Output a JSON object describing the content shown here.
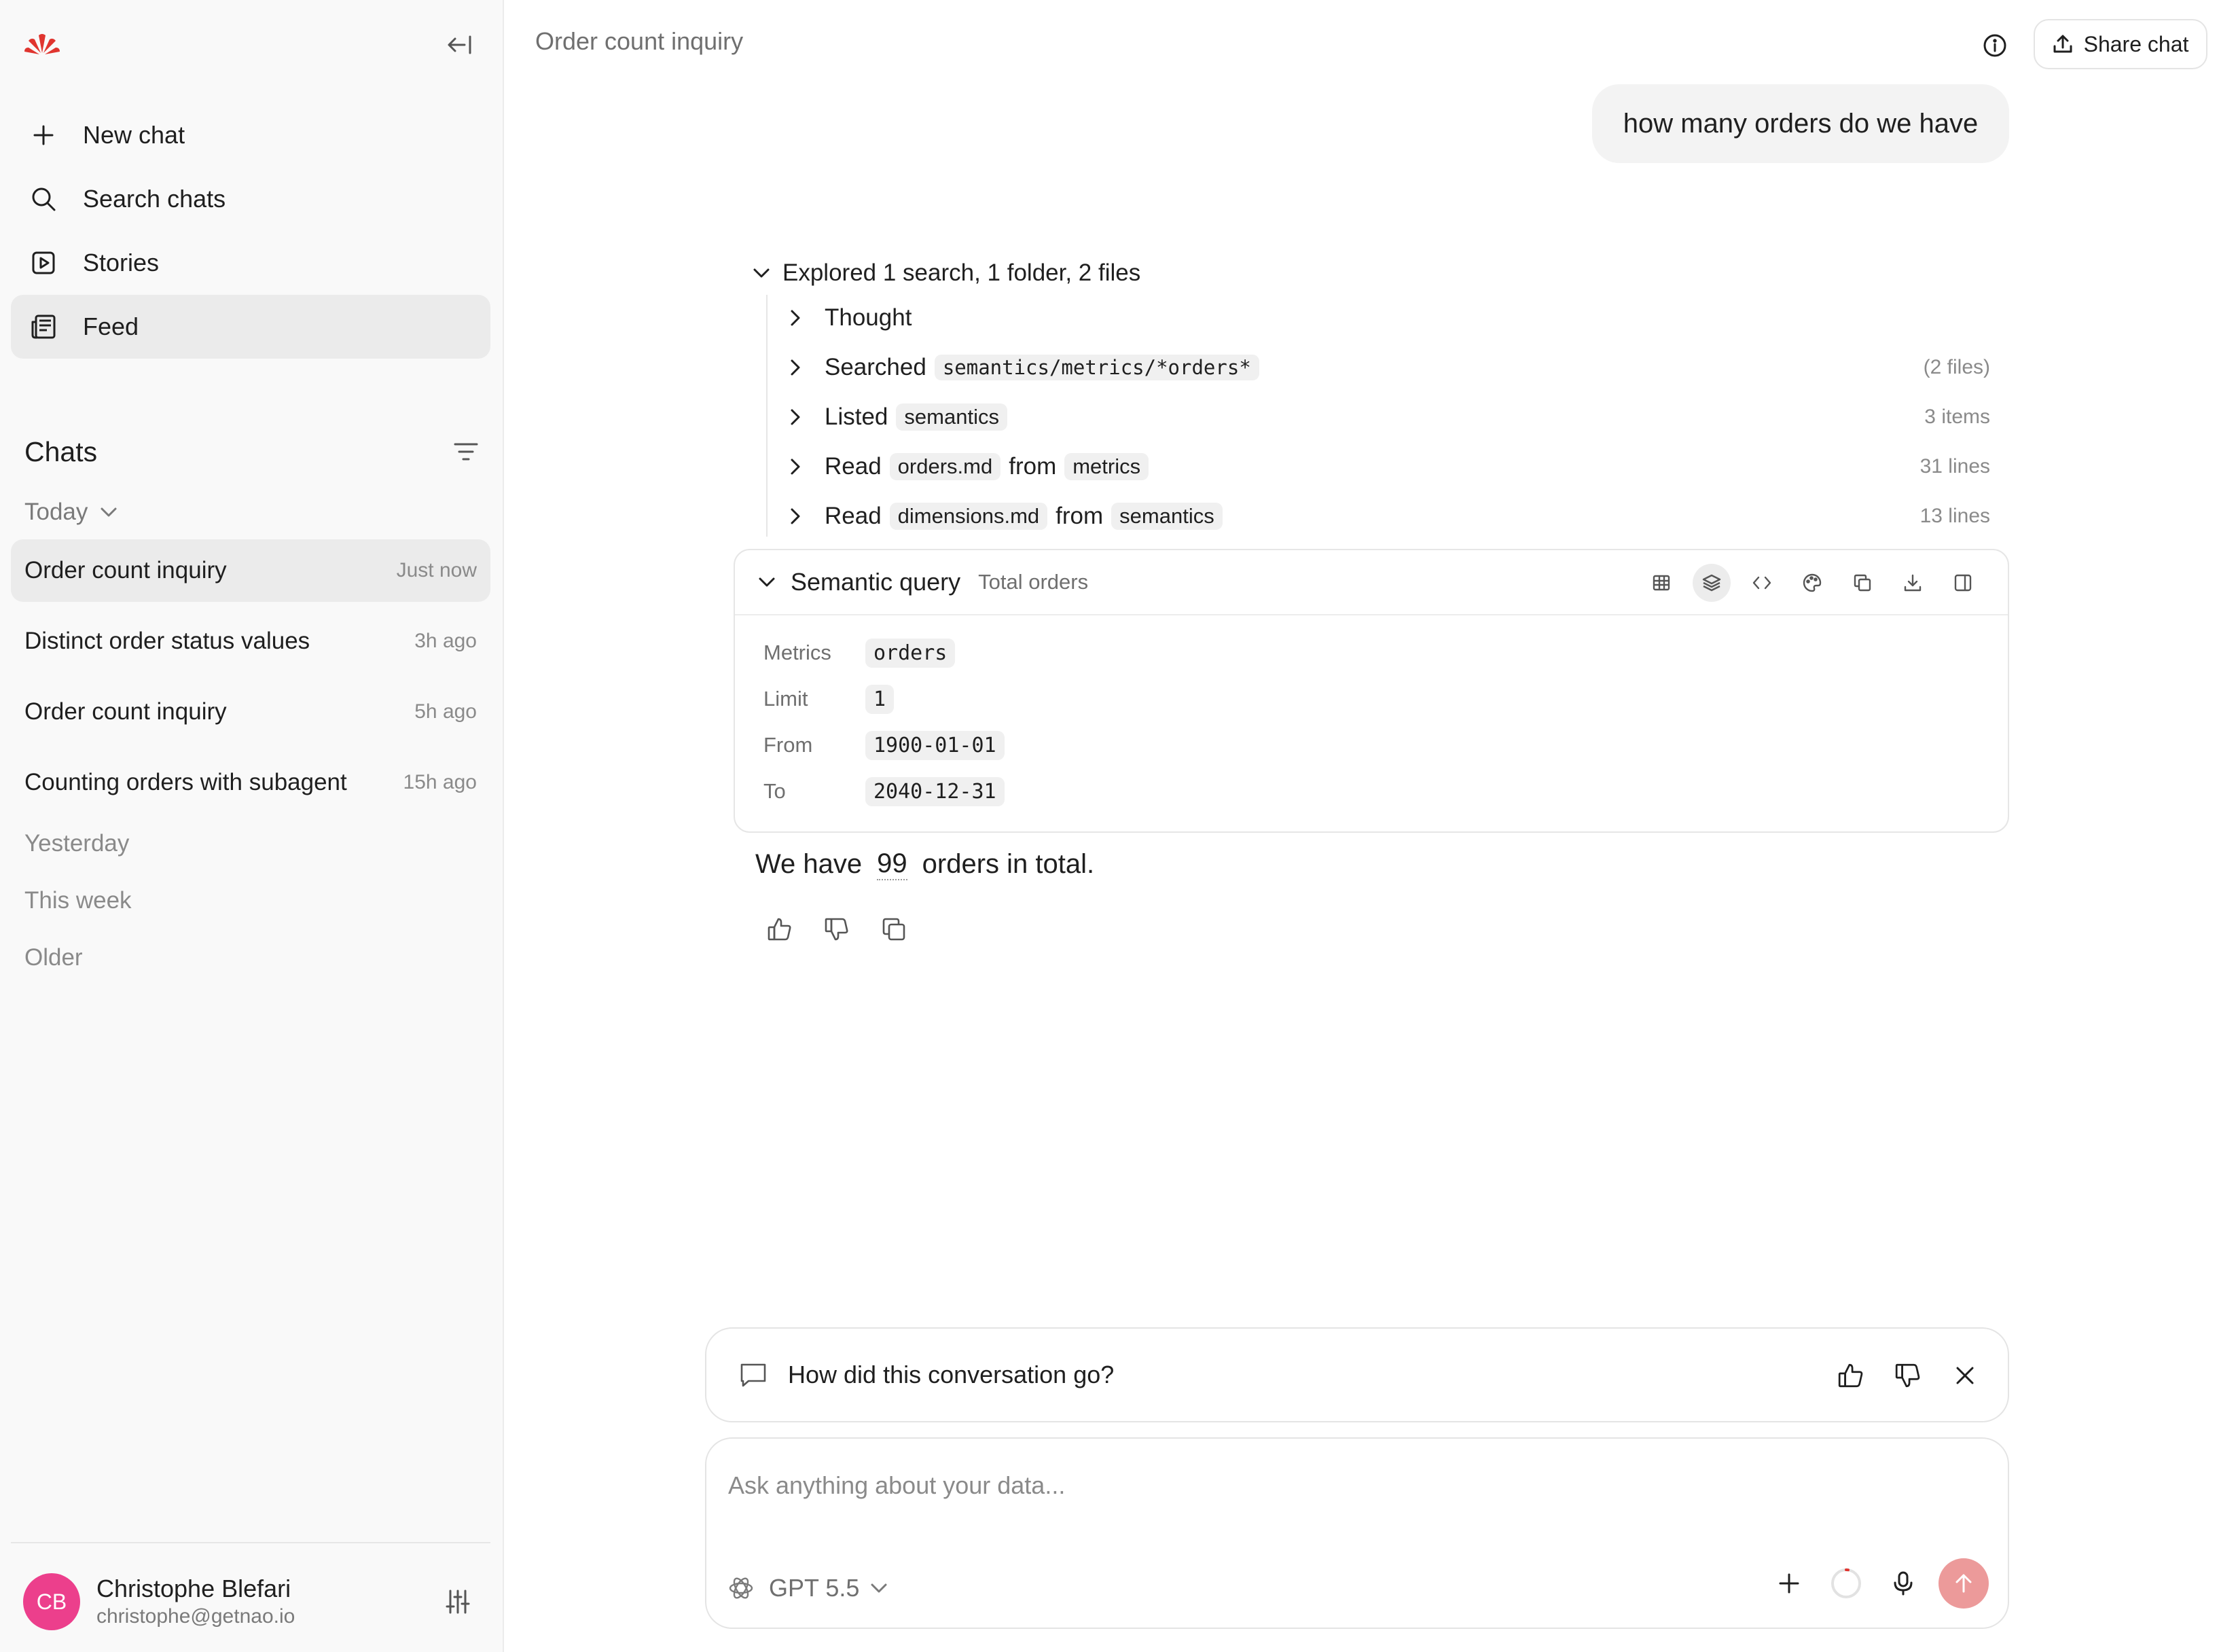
{
  "sidebar": {
    "nav": [
      {
        "label": "New chat",
        "icon": "plus-icon"
      },
      {
        "label": "Search chats",
        "icon": "search-icon"
      },
      {
        "label": "Stories",
        "icon": "play-square-icon"
      },
      {
        "label": "Feed",
        "icon": "newspaper-icon"
      }
    ],
    "chats_title": "Chats",
    "groups": {
      "today": "Today",
      "yesterday": "Yesterday",
      "this_week": "This week",
      "older": "Older"
    },
    "chats": [
      {
        "title": "Order count inquiry",
        "time": "Just now"
      },
      {
        "title": "Distinct order status values",
        "time": "3h ago"
      },
      {
        "title": "Order count inquiry",
        "time": "5h ago"
      },
      {
        "title": "Counting orders with subagent",
        "time": "15h ago"
      }
    ],
    "user": {
      "initials": "CB",
      "name": "Christophe Blefari",
      "email": "christophe@getnao.io"
    }
  },
  "header": {
    "title": "Order count inquiry",
    "share_label": "Share chat"
  },
  "conversation": {
    "user_message": "how many orders do we have",
    "explored_summary": "Explored 1 search, 1 folder, 2 files",
    "steps": {
      "thought": "Thought",
      "searched": {
        "verb": "Searched",
        "path": "semantics/metrics/*orders*",
        "meta": "(2 files)"
      },
      "listed": {
        "verb": "Listed",
        "target": "semantics",
        "meta": "3 items"
      },
      "read1": {
        "verb": "Read",
        "file": "orders.md",
        "from": "from",
        "dir": "metrics",
        "meta": "31 lines"
      },
      "read2": {
        "verb": "Read",
        "file": "dimensions.md",
        "from": "from",
        "dir": "semantics",
        "meta": "13 lines"
      }
    },
    "semantic_query": {
      "title": "Semantic query",
      "subtitle": "Total orders",
      "rows": [
        {
          "label": "Metrics",
          "value": "orders"
        },
        {
          "label": "Limit",
          "value": "1"
        },
        {
          "label": "From",
          "value": "1900-01-01"
        },
        {
          "label": "To",
          "value": "2040-12-31"
        }
      ]
    },
    "answer": {
      "prefix": "We have",
      "value": "99",
      "suffix": "orders in total."
    }
  },
  "feedback": {
    "question": "How did this conversation go?"
  },
  "composer": {
    "placeholder": "Ask anything about your data...",
    "model": "GPT 5.5"
  },
  "colors": {
    "brand": "#e0352f",
    "avatar": "#ec3f8c",
    "send": "#ec9a9a",
    "active_bg": "#ebebeb"
  }
}
